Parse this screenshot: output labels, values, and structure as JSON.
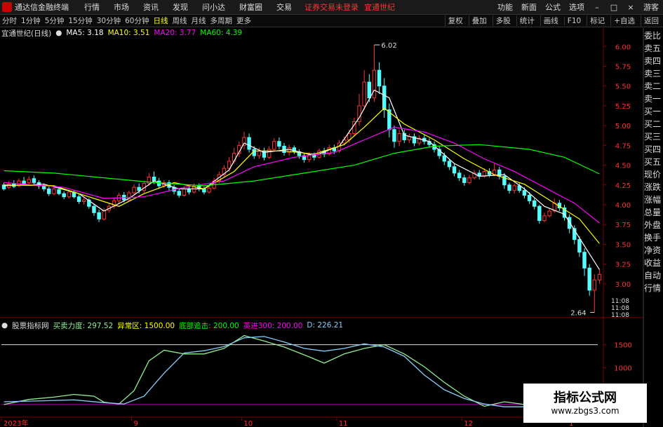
{
  "menu": {
    "app_title": "通达信金融终端",
    "items": [
      "行情",
      "市场",
      "资讯",
      "发现",
      "问小达",
      "财富圈",
      "交易"
    ],
    "notice": "证券交易未登录",
    "stock_name": "宜通世纪",
    "right_items": [
      "功能",
      "新面",
      "公式",
      "选项"
    ],
    "user": "游客"
  },
  "toolbar": {
    "periods": [
      "分时",
      "1分钟",
      "5分钟",
      "15分钟",
      "30分钟",
      "60分钟",
      "日线",
      "周线",
      "月线",
      "多周期",
      "更多"
    ],
    "active_period": "日线",
    "right_items": [
      "复权",
      "叠加",
      "多股",
      "统计",
      "画线",
      "F10",
      "标记",
      "+自选",
      "返回"
    ]
  },
  "legend": {
    "title": "宜通世纪(日线)",
    "ma5": "MA5: 3.18",
    "ma10": "MA10: 3.51",
    "ma20": "MA20: 3.77",
    "ma60": "MA60: 4.39",
    "colors": {
      "ma5": "#ffffff",
      "ma10": "#ffff00",
      "ma20": "#ff00ff",
      "ma60": "#00ff00"
    }
  },
  "chart_data": {
    "type": "line",
    "subtype": "candlestick",
    "y_ticks": [
      "6.00",
      "5.75",
      "5.50",
      "5.25",
      "5.00",
      "4.75",
      "4.50",
      "4.25",
      "4.00",
      "3.75",
      "3.50",
      "3.25",
      "3.00"
    ],
    "ylim": [
      2.6,
      6.1
    ],
    "high_label": "6.02",
    "low_label": "2.64",
    "time_labels": [
      "2023年",
      "9",
      "10",
      "11",
      "12",
      "1"
    ],
    "extra_right_labels": [
      "11:08",
      "11:08",
      "11:08"
    ],
    "up_color": "#ff3232",
    "down_color": "#54ffff",
    "candles": [
      [
        4.25,
        4.2,
        4.28,
        4.18
      ],
      [
        4.22,
        4.26,
        4.3,
        4.2
      ],
      [
        4.27,
        4.23,
        4.31,
        4.21
      ],
      [
        4.24,
        4.3,
        4.33,
        4.22
      ],
      [
        4.3,
        4.27,
        4.35,
        4.25
      ],
      [
        4.28,
        4.32,
        4.36,
        4.26
      ],
      [
        4.33,
        4.28,
        4.37,
        4.26
      ],
      [
        4.28,
        4.24,
        4.31,
        4.2
      ],
      [
        4.24,
        4.2,
        4.27,
        4.17
      ],
      [
        4.2,
        4.14,
        4.23,
        4.11
      ],
      [
        4.14,
        4.2,
        4.23,
        4.12
      ],
      [
        4.19,
        4.14,
        4.22,
        4.12
      ],
      [
        4.14,
        4.1,
        4.17,
        4.07
      ],
      [
        4.1,
        4.16,
        4.19,
        4.08
      ],
      [
        4.16,
        4.1,
        4.19,
        4.08
      ],
      [
        4.1,
        4.04,
        4.13,
        4.01
      ],
      [
        4.04,
        4.06,
        4.09,
        4.0
      ],
      [
        4.06,
        3.98,
        4.08,
        3.95
      ],
      [
        3.98,
        3.9,
        4.01,
        3.86
      ],
      [
        3.9,
        3.82,
        3.94,
        3.78
      ],
      [
        3.82,
        3.93,
        3.96,
        3.8
      ],
      [
        3.93,
        3.98,
        4.02,
        3.9
      ],
      [
        3.98,
        4.05,
        4.08,
        3.95
      ],
      [
        4.05,
        4.12,
        4.15,
        4.02
      ],
      [
        4.12,
        4.06,
        4.16,
        4.03
      ],
      [
        4.06,
        4.15,
        4.18,
        4.04
      ],
      [
        4.15,
        4.22,
        4.26,
        4.12
      ],
      [
        4.22,
        4.18,
        4.27,
        4.14
      ],
      [
        4.18,
        4.27,
        4.3,
        4.15
      ],
      [
        4.27,
        4.35,
        4.4,
        4.24
      ],
      [
        4.35,
        4.3,
        4.42,
        4.26
      ],
      [
        4.3,
        4.24,
        4.34,
        4.2
      ],
      [
        4.24,
        4.28,
        4.31,
        4.21
      ],
      [
        4.28,
        4.22,
        4.31,
        4.18
      ],
      [
        4.22,
        4.17,
        4.25,
        4.13
      ],
      [
        4.17,
        4.12,
        4.2,
        4.09
      ],
      [
        4.12,
        4.2,
        4.23,
        4.1
      ],
      [
        4.2,
        4.16,
        4.24,
        4.13
      ],
      [
        4.16,
        4.24,
        4.27,
        4.14
      ],
      [
        4.24,
        4.2,
        4.27,
        4.17
      ],
      [
        4.2,
        4.16,
        4.23,
        4.13
      ],
      [
        4.16,
        4.21,
        4.24,
        4.14
      ],
      [
        4.21,
        4.3,
        4.34,
        4.19
      ],
      [
        4.3,
        4.38,
        4.42,
        4.27
      ],
      [
        4.38,
        4.46,
        4.5,
        4.35
      ],
      [
        4.46,
        4.55,
        4.6,
        4.42
      ],
      [
        4.55,
        4.65,
        4.72,
        4.52
      ],
      [
        4.65,
        4.75,
        4.8,
        4.6
      ],
      [
        4.75,
        4.85,
        4.92,
        4.7
      ],
      [
        4.85,
        4.7,
        4.9,
        4.66
      ],
      [
        4.7,
        4.62,
        4.74,
        4.58
      ],
      [
        4.62,
        4.68,
        4.72,
        4.58
      ],
      [
        4.68,
        4.6,
        4.72,
        4.56
      ],
      [
        4.6,
        4.7,
        4.74,
        4.58
      ],
      [
        4.7,
        4.8,
        4.84,
        4.68
      ],
      [
        4.8,
        4.74,
        4.85,
        4.7
      ],
      [
        4.74,
        4.66,
        4.78,
        4.62
      ],
      [
        4.66,
        4.72,
        4.76,
        4.62
      ],
      [
        4.72,
        4.67,
        4.75,
        4.64
      ],
      [
        4.67,
        4.62,
        4.7,
        4.58
      ],
      [
        4.62,
        4.57,
        4.65,
        4.53
      ],
      [
        4.57,
        4.63,
        4.66,
        4.54
      ],
      [
        4.63,
        4.6,
        4.66,
        4.56
      ],
      [
        4.6,
        4.68,
        4.71,
        4.58
      ],
      [
        4.68,
        4.64,
        4.72,
        4.6
      ],
      [
        4.64,
        4.72,
        4.76,
        4.62
      ],
      [
        4.72,
        4.68,
        4.76,
        4.64
      ],
      [
        4.68,
        4.78,
        4.82,
        4.66
      ],
      [
        4.78,
        4.82,
        4.86,
        4.75
      ],
      [
        4.82,
        4.9,
        4.95,
        4.78
      ],
      [
        4.9,
        5.05,
        5.1,
        4.86
      ],
      [
        5.05,
        5.25,
        5.4,
        5.0
      ],
      [
        5.25,
        5.55,
        5.7,
        5.2
      ],
      [
        5.55,
        5.35,
        5.65,
        5.3
      ],
      [
        5.35,
        5.7,
        6.02,
        5.3
      ],
      [
        5.7,
        5.5,
        5.8,
        5.4
      ],
      [
        5.5,
        5.2,
        5.6,
        5.1
      ],
      [
        5.2,
        4.95,
        5.28,
        4.85
      ],
      [
        4.95,
        4.8,
        5.0,
        4.72
      ],
      [
        4.8,
        4.9,
        4.95,
        4.74
      ],
      [
        4.9,
        4.82,
        4.95,
        4.78
      ],
      [
        4.82,
        4.86,
        4.9,
        4.78
      ],
      [
        4.86,
        4.78,
        4.9,
        4.74
      ],
      [
        4.78,
        4.84,
        4.88,
        4.75
      ],
      [
        4.84,
        4.8,
        4.88,
        4.76
      ],
      [
        4.8,
        4.76,
        4.84,
        4.72
      ],
      [
        4.76,
        4.7,
        4.8,
        4.66
      ],
      [
        4.7,
        4.62,
        4.74,
        4.58
      ],
      [
        4.62,
        4.55,
        4.66,
        4.5
      ],
      [
        4.55,
        4.48,
        4.58,
        4.44
      ],
      [
        4.48,
        4.4,
        4.52,
        4.36
      ],
      [
        4.4,
        4.34,
        4.44,
        4.3
      ],
      [
        4.34,
        4.28,
        4.38,
        4.24
      ],
      [
        4.28,
        4.34,
        4.38,
        4.26
      ],
      [
        4.34,
        4.4,
        4.44,
        4.32
      ],
      [
        4.4,
        4.36,
        4.44,
        4.32
      ],
      [
        4.36,
        4.42,
        4.46,
        4.34
      ],
      [
        4.42,
        4.38,
        4.46,
        4.35
      ],
      [
        4.38,
        4.44,
        4.52,
        4.36
      ],
      [
        4.44,
        4.36,
        4.48,
        4.32
      ],
      [
        4.36,
        4.25,
        4.4,
        4.2
      ],
      [
        4.25,
        4.18,
        4.28,
        4.14
      ],
      [
        4.18,
        4.24,
        4.27,
        4.14
      ],
      [
        4.24,
        4.18,
        4.28,
        4.15
      ],
      [
        4.18,
        4.12,
        4.22,
        4.08
      ],
      [
        4.12,
        4.05,
        4.16,
        4.01
      ],
      [
        4.05,
        3.98,
        4.08,
        3.94
      ],
      [
        3.98,
        3.8,
        4.0,
        3.76
      ],
      [
        3.8,
        3.86,
        3.9,
        3.78
      ],
      [
        3.86,
        3.92,
        3.96,
        3.84
      ],
      [
        3.92,
        4.02,
        4.08,
        3.9
      ],
      [
        4.02,
        3.96,
        4.06,
        3.92
      ],
      [
        3.96,
        3.84,
        4.0,
        3.8
      ],
      [
        3.84,
        3.7,
        3.88,
        3.64
      ],
      [
        3.7,
        3.56,
        3.74,
        3.5
      ],
      [
        3.56,
        3.4,
        3.6,
        3.34
      ],
      [
        3.4,
        3.2,
        3.45,
        3.1
      ],
      [
        3.2,
        2.92,
        3.25,
        2.85
      ],
      [
        2.92,
        3.05,
        3.12,
        2.64
      ],
      [
        3.05,
        3.12,
        3.18,
        3.0
      ]
    ],
    "ma_series": [
      {
        "name": "MA5",
        "color": "#ffffff",
        "points": [
          [
            0,
            4.24
          ],
          [
            8,
            4.26
          ],
          [
            15,
            4.14
          ],
          [
            20,
            3.92
          ],
          [
            25,
            4.08
          ],
          [
            30,
            4.3
          ],
          [
            35,
            4.2
          ],
          [
            40,
            4.2
          ],
          [
            45,
            4.44
          ],
          [
            48,
            4.78
          ],
          [
            52,
            4.66
          ],
          [
            57,
            4.7
          ],
          [
            62,
            4.62
          ],
          [
            67,
            4.74
          ],
          [
            71,
            5.1
          ],
          [
            74,
            5.45
          ],
          [
            77,
            5.35
          ],
          [
            80,
            4.88
          ],
          [
            85,
            4.8
          ],
          [
            90,
            4.52
          ],
          [
            95,
            4.36
          ],
          [
            100,
            4.38
          ],
          [
            104,
            4.2
          ],
          [
            108,
            3.98
          ],
          [
            112,
            3.88
          ],
          [
            116,
            3.48
          ],
          [
            119,
            3.18
          ]
        ]
      },
      {
        "name": "MA10",
        "color": "#ffff00",
        "points": [
          [
            0,
            4.25
          ],
          [
            10,
            4.24
          ],
          [
            18,
            4.08
          ],
          [
            23,
            3.98
          ],
          [
            28,
            4.14
          ],
          [
            34,
            4.28
          ],
          [
            40,
            4.2
          ],
          [
            46,
            4.42
          ],
          [
            50,
            4.68
          ],
          [
            56,
            4.68
          ],
          [
            62,
            4.64
          ],
          [
            68,
            4.76
          ],
          [
            72,
            4.98
          ],
          [
            76,
            5.22
          ],
          [
            80,
            5.02
          ],
          [
            86,
            4.82
          ],
          [
            92,
            4.58
          ],
          [
            98,
            4.38
          ],
          [
            104,
            4.26
          ],
          [
            110,
            4.02
          ],
          [
            115,
            3.82
          ],
          [
            119,
            3.51
          ]
        ]
      },
      {
        "name": "MA20",
        "color": "#ff00ff",
        "points": [
          [
            0,
            4.28
          ],
          [
            12,
            4.22
          ],
          [
            20,
            4.08
          ],
          [
            28,
            4.1
          ],
          [
            36,
            4.22
          ],
          [
            44,
            4.3
          ],
          [
            50,
            4.48
          ],
          [
            58,
            4.6
          ],
          [
            66,
            4.66
          ],
          [
            72,
            4.82
          ],
          [
            78,
            4.98
          ],
          [
            84,
            4.92
          ],
          [
            90,
            4.78
          ],
          [
            96,
            4.58
          ],
          [
            102,
            4.42
          ],
          [
            108,
            4.22
          ],
          [
            114,
            4.02
          ],
          [
            119,
            3.77
          ]
        ]
      },
      {
        "name": "MA60",
        "color": "#00ff00",
        "points": [
          [
            0,
            4.43
          ],
          [
            10,
            4.4
          ],
          [
            20,
            4.34
          ],
          [
            30,
            4.28
          ],
          [
            40,
            4.24
          ],
          [
            50,
            4.3
          ],
          [
            60,
            4.4
          ],
          [
            70,
            4.5
          ],
          [
            78,
            4.65
          ],
          [
            86,
            4.74
          ],
          [
            95,
            4.76
          ],
          [
            105,
            4.7
          ],
          [
            112,
            4.6
          ],
          [
            119,
            4.39
          ]
        ]
      }
    ]
  },
  "indicator": {
    "title": "股票指标网",
    "buy_sell": "买卖力度: 297.52",
    "anomaly": "异常区: 1500.00",
    "bottom": "底部追击: 200.00",
    "strong": "英进300: 200.00",
    "d_value": "D: 226.21",
    "y_ticks": [
      "1500",
      "1000"
    ],
    "ylim": [
      0,
      1800
    ],
    "reference_lines": [
      1500,
      200
    ],
    "lines": [
      {
        "name": "买卖力度",
        "color": "#90ee90",
        "points": [
          [
            0,
            200
          ],
          [
            5,
            310
          ],
          [
            10,
            360
          ],
          [
            14,
            420
          ],
          [
            18,
            380
          ],
          [
            20,
            250
          ],
          [
            23,
            210
          ],
          [
            26,
            500
          ],
          [
            29,
            1150
          ],
          [
            32,
            1380
          ],
          [
            36,
            1300
          ],
          [
            40,
            1300
          ],
          [
            44,
            1420
          ],
          [
            48,
            1700
          ],
          [
            52,
            1580
          ],
          [
            56,
            1450
          ],
          [
            60,
            1280
          ],
          [
            64,
            1100
          ],
          [
            68,
            1300
          ],
          [
            72,
            1420
          ],
          [
            76,
            1500
          ],
          [
            80,
            1300
          ],
          [
            84,
            1020
          ],
          [
            88,
            680
          ],
          [
            92,
            380
          ],
          [
            96,
            160
          ],
          [
            100,
            260
          ],
          [
            104,
            200
          ],
          [
            108,
            170
          ],
          [
            112,
            230
          ],
          [
            116,
            250
          ],
          [
            119,
            300
          ]
        ]
      },
      {
        "name": "D",
        "color": "#87cefa",
        "points": [
          [
            0,
            260
          ],
          [
            8,
            280
          ],
          [
            14,
            300
          ],
          [
            20,
            240
          ],
          [
            24,
            210
          ],
          [
            28,
            380
          ],
          [
            32,
            880
          ],
          [
            36,
            1320
          ],
          [
            40,
            1370
          ],
          [
            44,
            1460
          ],
          [
            48,
            1650
          ],
          [
            52,
            1680
          ],
          [
            56,
            1560
          ],
          [
            60,
            1420
          ],
          [
            64,
            1360
          ],
          [
            68,
            1420
          ],
          [
            72,
            1520
          ],
          [
            76,
            1450
          ],
          [
            80,
            1250
          ],
          [
            84,
            840
          ],
          [
            88,
            520
          ],
          [
            92,
            330
          ],
          [
            96,
            210
          ],
          [
            100,
            150
          ],
          [
            104,
            150
          ],
          [
            108,
            170
          ],
          [
            112,
            200
          ],
          [
            116,
            210
          ],
          [
            119,
            226
          ]
        ]
      }
    ]
  },
  "sidebar": [
    "委比",
    "卖五",
    "卖四",
    "卖三",
    "卖二",
    "卖一",
    "买一",
    "买二",
    "买三",
    "买四",
    "买五",
    "现价",
    "涨跌",
    "涨幅",
    "总量",
    "外盘",
    "换手",
    "净资",
    "收益",
    "自动",
    "行情"
  ],
  "watermark": {
    "title": "指标公式网",
    "url": "www.zbgs3.com"
  }
}
